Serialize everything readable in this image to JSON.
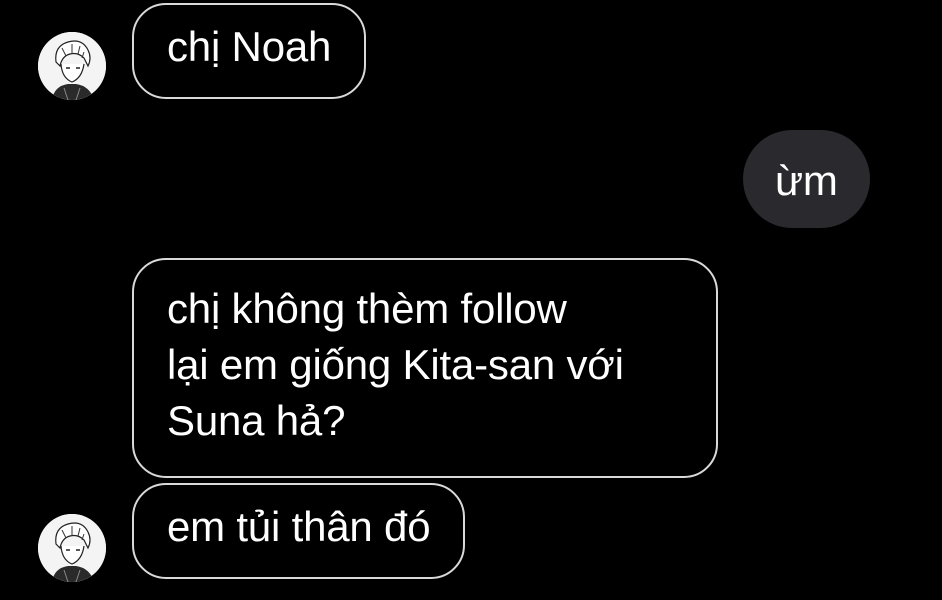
{
  "colors": {
    "background": "#000000",
    "incoming_border": "#d9d9d9",
    "outgoing_bubble": "#2a2a2e",
    "text": "#ffffff"
  },
  "messages": [
    {
      "direction": "incoming",
      "text": "chị Noah",
      "avatar": "user-avatar-icon"
    },
    {
      "direction": "outgoing",
      "text": "ừm"
    },
    {
      "direction": "incoming",
      "lines": [
        "chị không thèm follow",
        "lại em giống Kita-san với",
        "Suna hả?"
      ]
    },
    {
      "direction": "incoming",
      "text": "em tủi thân đó",
      "avatar": "user-avatar-icon"
    }
  ]
}
